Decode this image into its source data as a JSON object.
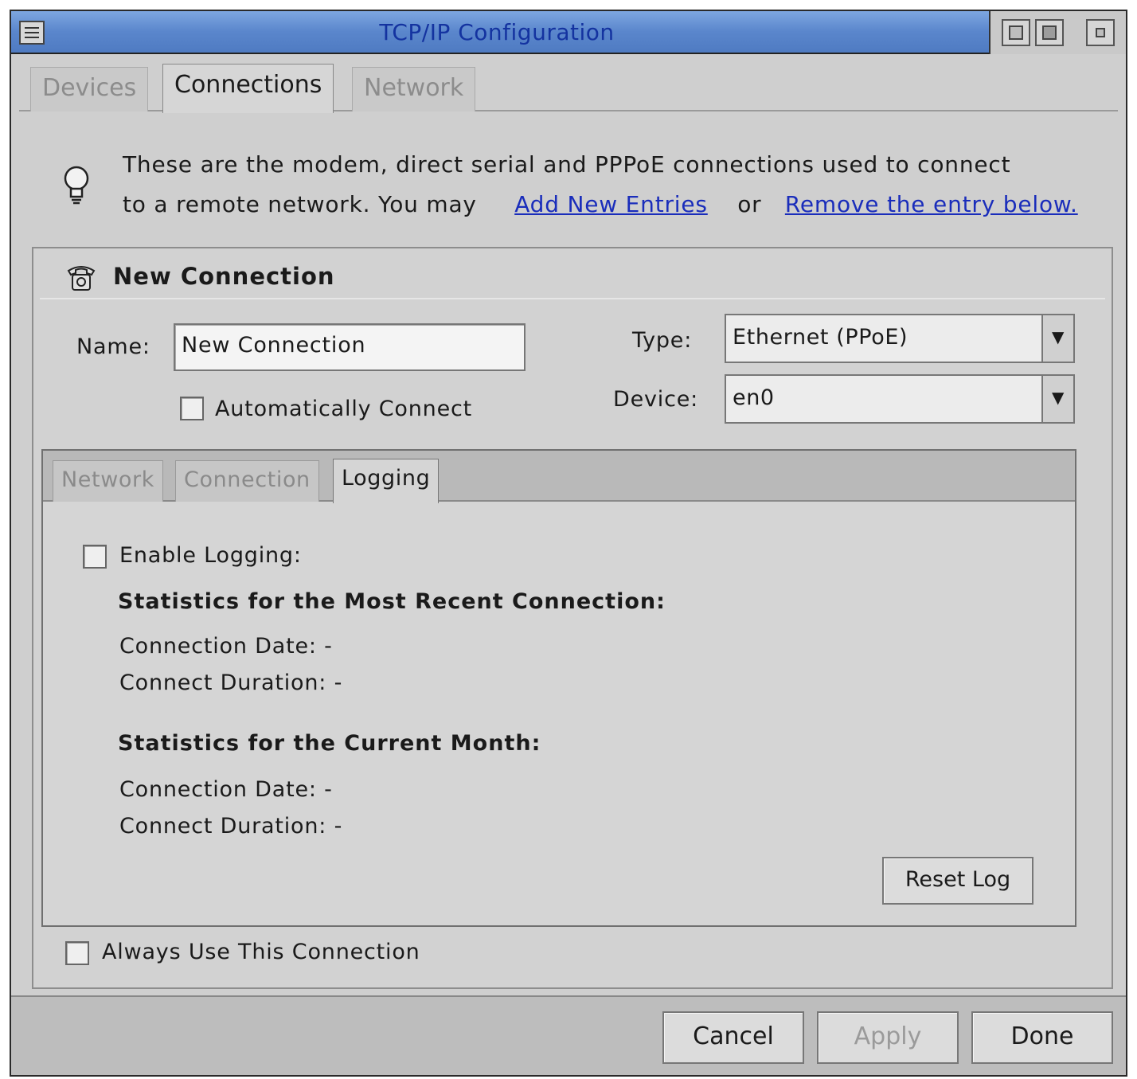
{
  "window": {
    "title": "TCP/IP Configuration"
  },
  "tabs": [
    {
      "label": "Devices",
      "active": false
    },
    {
      "label": "Connections",
      "active": true
    },
    {
      "label": "Network",
      "active": false
    }
  ],
  "info": {
    "line1": "These are the modem, direct serial and PPPoE connections used to connect",
    "line2_prefix": "to a remote network. You may",
    "add_link": "Add New Entries",
    "or": "or",
    "remove_link": "Remove the entry below."
  },
  "connection": {
    "title": "New Connection",
    "name_label": "Name:",
    "name_value": "New Connection",
    "auto_connect_label": "Automatically Connect",
    "auto_connect_checked": false,
    "type_label": "Type:",
    "type_value": "Ethernet (PPoE)",
    "device_label": "Device:",
    "device_value": "en0"
  },
  "subtabs": [
    {
      "label": "Network",
      "active": false
    },
    {
      "label": "Connection",
      "active": false
    },
    {
      "label": "Logging",
      "active": true
    }
  ],
  "logging": {
    "enable_label": "Enable Logging:",
    "enable_checked": false,
    "recent_heading": "Statistics for the Most Recent Connection:",
    "recent_date": "Connection Date:  -",
    "recent_duration": "Connect Duration:  -",
    "month_heading": "Statistics for the Current Month:",
    "month_date": "Connection Date:  -",
    "month_duration": "Connect Duration:  -",
    "reset_label": "Reset Log"
  },
  "always_use_label": "Always Use This Connection",
  "footer": {
    "cancel": "Cancel",
    "apply": "Apply",
    "done": "Done"
  }
}
